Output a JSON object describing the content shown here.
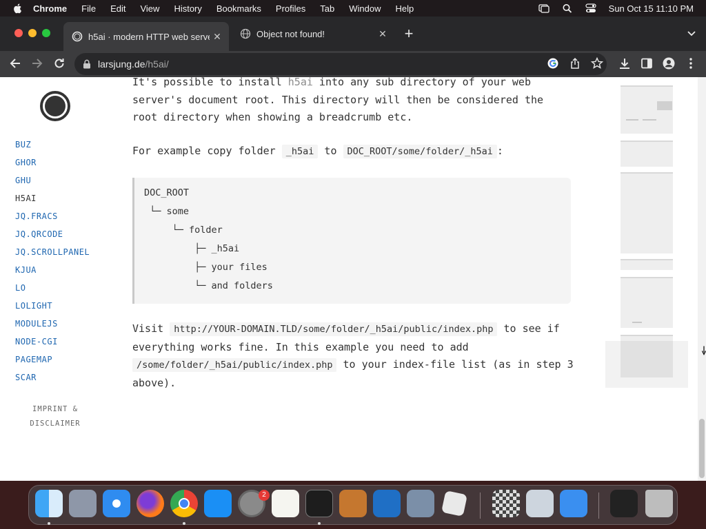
{
  "menubar": {
    "app_name": "Chrome",
    "items": [
      "File",
      "Edit",
      "View",
      "History",
      "Bookmarks",
      "Profiles",
      "Tab",
      "Window",
      "Help"
    ],
    "clock": "Sun Oct 15  11:10 PM"
  },
  "tabs": [
    {
      "title": "h5ai · modern HTTP web serve",
      "active": true
    },
    {
      "title": "Object not found!",
      "active": false
    }
  ],
  "address_bar": {
    "host": "larsjung.de",
    "path": "/h5ai/"
  },
  "sidebar": {
    "nav_items": [
      "BUZ",
      "GHOR",
      "GHU",
      "H5AI",
      "JQ.FRACS",
      "JQ.QRCODE",
      "JQ.SCROLLPANEL",
      "KJUA",
      "LO",
      "LOLIGHT",
      "MODULEJS",
      "NODE-CGI",
      "PAGEMAP",
      "SCAR"
    ],
    "current_item": "H5AI",
    "imprint_line1": "IMPRINT &",
    "imprint_line2": "DISCLAIMER"
  },
  "content": {
    "p1_a": "It's possible to install ",
    "p1_h5ai": "h5ai",
    "p1_b": " into any sub directory of your web server's document root. This directory will then be considered the root directory when showing a breadcrumb etc.",
    "p2_a": "For example copy folder ",
    "p2_code1": "_h5ai",
    "p2_b": " to ",
    "p2_code2": "DOC_ROOT/some/folder/_h5ai",
    "p2_c": ":",
    "code_lines": [
      "DOC_ROOT",
      " └─ some",
      "     └─ folder",
      "         ├─ _h5ai",
      "         ├─ your files",
      "         └─ and folders"
    ],
    "p3_a": "Visit ",
    "p3_code1": "http://YOUR-DOMAIN.TLD/some/folder/_h5ai/public/index.php",
    "p3_b": " to see if everything works fine. In this example you need to add ",
    "p3_code2": "/some/folder/_h5ai/public/index.php",
    "p3_c": " to your index-file list (as in step 3 above)."
  },
  "dock": {
    "apps": [
      "Finder",
      "Launchpad",
      "Safari",
      "Firefox",
      "Chrome",
      "App Store",
      "System Preferences",
      "TextEdit",
      "Terminal",
      "GarageBand",
      "Visual Studio Code",
      "VirtualBox",
      "Roblox",
      "Chess",
      "Utility",
      "Mail",
      "Window Preview",
      "Trash"
    ],
    "settings_badge": "2"
  },
  "colors": {
    "link": "#1e66b0",
    "accent_tab": "#3c3c3e",
    "code_bg": "#f4f4f4"
  }
}
